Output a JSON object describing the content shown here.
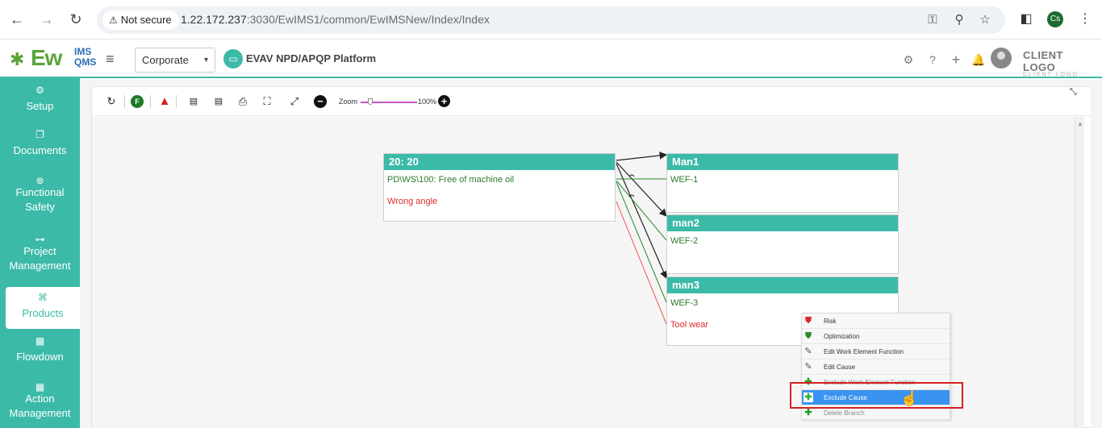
{
  "browser": {
    "security_label": "Not secure",
    "url_host": "1.22.172.237",
    "url_rest": ":3030/EwIMS1/common/EwIMSNew/Index/Index",
    "profile_initials": "Cs"
  },
  "header": {
    "logo_ew": "Ew",
    "logo_ims": "IMS",
    "logo_qms": "QMS",
    "org_select": "Corporate",
    "platform_title": "EVAV NPD/APQP Platform",
    "client_logo": "CLIENT LOGO",
    "client_logo_sub": "CLIENT LOGO"
  },
  "sidebar": {
    "items": [
      {
        "label": "Setup",
        "icon": "gears-icon"
      },
      {
        "label": "Documents",
        "icon": "documents-icon"
      },
      {
        "label": "Functional Safety",
        "icon": "safety-icon"
      },
      {
        "label": "Project Management",
        "icon": "hierarchy-icon"
      },
      {
        "label": "Products",
        "icon": "product-icon",
        "active": true
      },
      {
        "label": "Flowdown",
        "icon": "building-icon"
      },
      {
        "label": "Action Management",
        "icon": "building-icon"
      }
    ]
  },
  "toolbar": {
    "zoom_label": "Zoom",
    "zoom_value": "100%",
    "f_label": "F",
    "alert_label": "!"
  },
  "nodes": {
    "source": {
      "title": "20: 20",
      "function": "PD\\WS\\100: Free of machine oil",
      "failure": "Wrong angle"
    },
    "man1": {
      "title": "Man1",
      "function": "WEF-1"
    },
    "man2": {
      "title": "man2",
      "function": "WEF-2"
    },
    "man3": {
      "title": "man3",
      "function": "WEF-3",
      "cause": "Tool wear"
    }
  },
  "context_menu": {
    "items": [
      {
        "label": "Risk",
        "icon": "shield-red-icon"
      },
      {
        "label": "Optimization",
        "icon": "shield-green-icon"
      },
      {
        "label": "Edit Work Element Function",
        "icon": "edit-icon"
      },
      {
        "label": "Edit Cause",
        "icon": "edit-icon"
      },
      {
        "label": "Exclude Work Element Function",
        "icon": "plus-icon"
      },
      {
        "label": "Exclude Cause",
        "icon": "plus-icon",
        "highlighted": true
      },
      {
        "label": "Delete Branch",
        "icon": "plus-icon"
      }
    ]
  },
  "colors": {
    "accent": "#3cbaa8",
    "highlight": "#3a93f0",
    "failure_red": "#e02a2a",
    "function_green": "#2a7a2a"
  }
}
